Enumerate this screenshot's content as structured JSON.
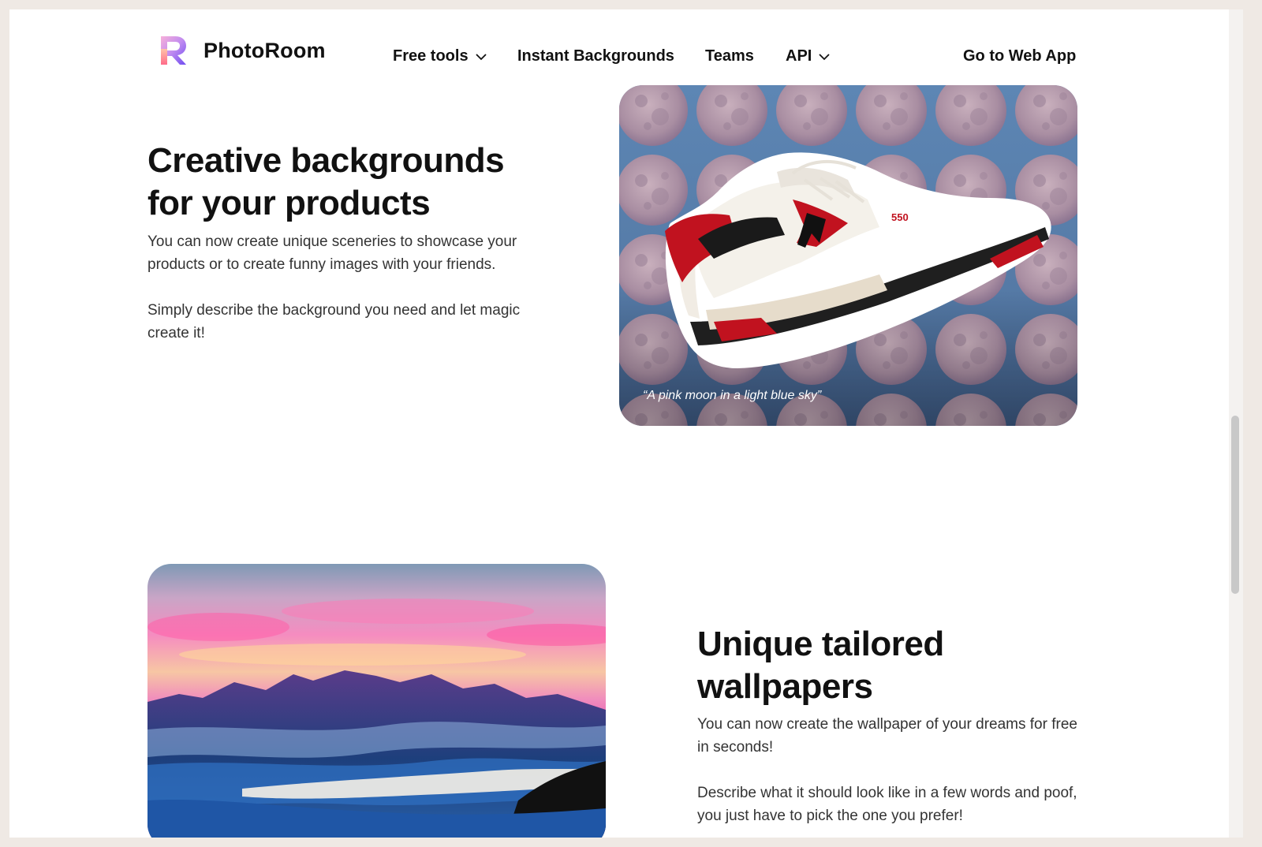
{
  "nav": {
    "brand": "PhotoRoom",
    "items": [
      {
        "label": "Free tools",
        "has_dropdown": true
      },
      {
        "label": "Instant Backgrounds",
        "has_dropdown": false
      },
      {
        "label": "Teams",
        "has_dropdown": false
      },
      {
        "label": "API",
        "has_dropdown": true
      }
    ],
    "cta": "Go to Web App"
  },
  "section1": {
    "title_line1": "Creative backgrounds",
    "title_line2": "for your products",
    "para1_line1": "You can now create unique sceneries to showcase your",
    "para1_line2": "products or to create funny images with your friends.",
    "para2_line1": "Simply describe the background you need and let magic",
    "para2_line2": "create it!",
    "image_caption": "“A pink moon in a light blue sky”",
    "shoe_badge": "550"
  },
  "section2": {
    "title_line1": "Unique tailored",
    "title_line2": "wallpapers",
    "para1_line1": "You can now create the wallpaper of your dreams for free",
    "para1_line2": "in seconds!",
    "para2_line1": "Describe what it should look like in a few words and poof,",
    "para2_line2": "you just have to pick the one you prefer!"
  },
  "colors": {
    "sky_blue": "#5d86b4",
    "moon_pink": "#b39aa8",
    "shoe_red": "#c1121f"
  }
}
